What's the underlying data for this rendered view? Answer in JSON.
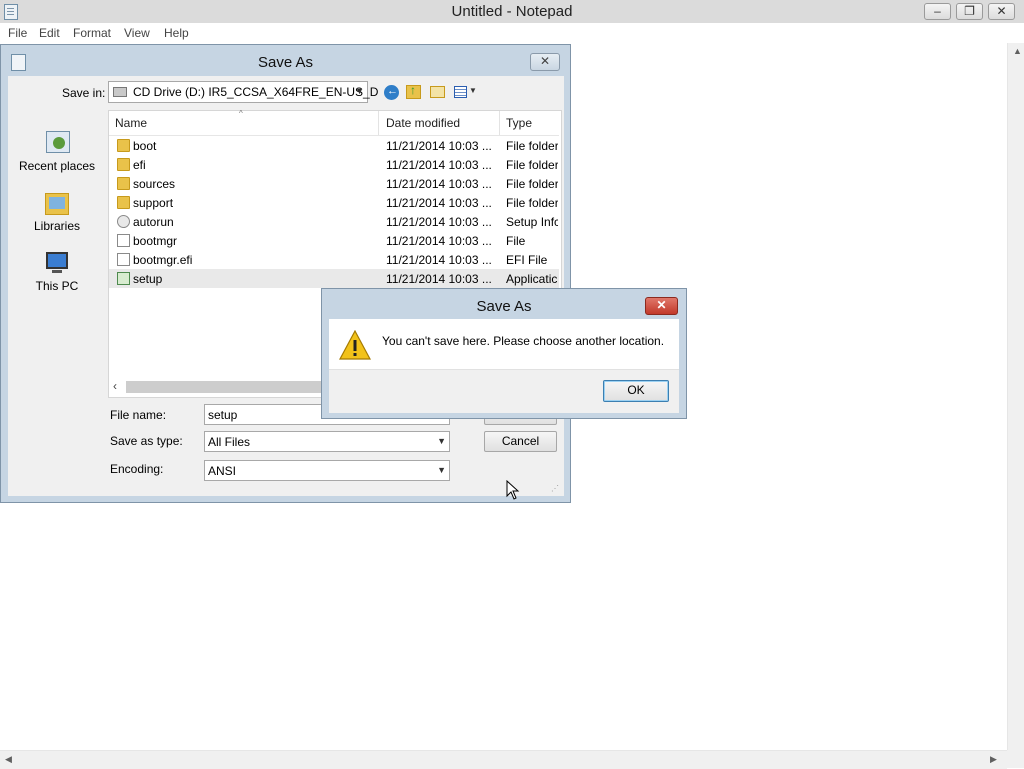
{
  "window": {
    "title": "Untitled - Notepad",
    "controls": {
      "minimize": "‒",
      "restore": "❐",
      "close": "✕"
    }
  },
  "menubar": {
    "items": [
      "File",
      "Edit",
      "Format",
      "View",
      "Help"
    ]
  },
  "save_dialog": {
    "title": "Save As",
    "save_in_label": "Save in:",
    "save_in_value": "CD Drive (D:) IR5_CCSA_X64FRE_EN-US_D",
    "places": [
      "Recent places",
      "Libraries",
      "This PC"
    ],
    "columns": [
      "Name",
      "Date modified",
      "Type"
    ],
    "files": [
      {
        "name": "boot",
        "date": "11/21/2014 10:03 ...",
        "type": "File folder",
        "icon": "folder-icon"
      },
      {
        "name": "efi",
        "date": "11/21/2014 10:03 ...",
        "type": "File folder",
        "icon": "folder-icon"
      },
      {
        "name": "sources",
        "date": "11/21/2014 10:03 ...",
        "type": "File folder",
        "icon": "folder-icon"
      },
      {
        "name": "support",
        "date": "11/21/2014 10:03 ...",
        "type": "File folder",
        "icon": "folder-icon"
      },
      {
        "name": "autorun",
        "date": "11/21/2014 10:03 ...",
        "type": "Setup Infc",
        "icon": "settings-file-icon"
      },
      {
        "name": "bootmgr",
        "date": "11/21/2014 10:03 ...",
        "type": "File",
        "icon": "file-icon"
      },
      {
        "name": "bootmgr.efi",
        "date": "11/21/2014 10:03 ...",
        "type": "EFI File",
        "icon": "file-icon"
      },
      {
        "name": "setup",
        "date": "11/21/2014 10:03 ...",
        "type": "Applicatic",
        "icon": "setup-app-icon"
      }
    ],
    "file_name_label": "File name:",
    "file_name_value": "setup",
    "save_as_type_label": "Save as type:",
    "save_as_type_value": "All Files",
    "encoding_label": "Encoding:",
    "encoding_value": "ANSI",
    "cancel_label": "Cancel"
  },
  "alert": {
    "title": "Save As",
    "message": "You can't save here. Please choose another location.",
    "ok_label": "OK"
  },
  "colors": {
    "dialog_frame": "#c6d5e3",
    "alert_close": "#c2392a",
    "folder": "#e9c24a"
  }
}
